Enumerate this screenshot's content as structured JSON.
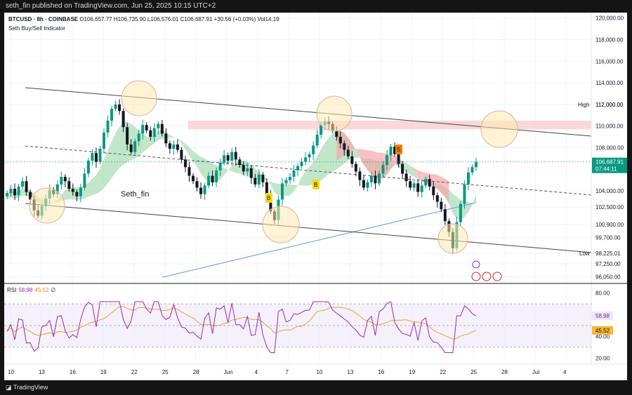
{
  "header": {
    "publisher_line": "seth_fin published on TradingView.com, Jun 25, 2025 10:15 UTC+2"
  },
  "legend": {
    "symbol": "BTCUSD · 8h · COINBASE",
    "ohlc": "O106,657.77 H106,735.90 L106,576.01 C106,687.91 +30.56 (+0.03%) Vol14.19",
    "indicator": "Seth Buy/Sell Indicator"
  },
  "watermark": "Seth_fin",
  "price_labels": {
    "high_label": "High",
    "high_value": "112,000.00",
    "low_label": "Low",
    "low_value": "98,225.01",
    "current_price": "106,687.91",
    "countdown": "07:44:11"
  },
  "rsi_legend": {
    "name": "RSI",
    "value1": "58.98",
    "value2": "45.52",
    "icon": "∅"
  },
  "rsi_labels": {
    "rsi": "58.98",
    "ma": "45.52"
  },
  "signals": [
    "B",
    "B",
    "S"
  ],
  "footer": {
    "brand": "TradingView"
  },
  "colors": {
    "up": "#089981",
    "down": "#131722",
    "cloud_green": "#8fd19e",
    "cloud_red": "#f3a6aa",
    "resistance_zone": "#f8c8ca",
    "circle_fill": "#fde9b0",
    "circle_stroke": "#e0b0a0",
    "ma_blue": "#7aa7e0",
    "rsi_line": "#9c27b0",
    "rsi_ma": "#f0a030",
    "rsi_band": "#ede7f6",
    "buy_badge": "#f5d90a",
    "sell_badge": "#f57c00",
    "price_tag": "#089981"
  },
  "chart_data": {
    "type": "candlestick",
    "symbol": "BTCUSD",
    "exchange": "COINBASE",
    "timeframe": "8h",
    "price_axis": {
      "ticks": [
        "120,000.00",
        "118,000.00",
        "116,000.00",
        "114,000.00",
        "112,000.00",
        "110,000.00",
        "108,000.00",
        "104,000.00",
        "102,500.00",
        "100,900.00",
        "99,700.00",
        "98,225.01",
        "97,250.00",
        "96,050.00"
      ],
      "range": [
        95500,
        120500
      ]
    },
    "time_axis": {
      "ticks": [
        "10",
        "13",
        "16",
        "19",
        "22",
        "25",
        "28",
        "Jun",
        "4",
        "7",
        "10",
        "13",
        "16",
        "19",
        "22",
        "25",
        "28",
        "Jul",
        "4"
      ]
    },
    "series_close": [
      103800,
      104200,
      103600,
      104400,
      104900,
      103900,
      103200,
      102200,
      101700,
      102600,
      103300,
      104100,
      103700,
      104600,
      105300,
      104900,
      104200,
      103900,
      103500,
      104300,
      105600,
      106800,
      107500,
      106700,
      107900,
      109400,
      110500,
      111600,
      112000,
      111400,
      109900,
      108300,
      107600,
      108600,
      109300,
      110100,
      109600,
      109000,
      109800,
      110200,
      109300,
      108400,
      107900,
      108300,
      107800,
      106900,
      106200,
      105400,
      104900,
      104300,
      103700,
      104500,
      105400,
      104800,
      105900,
      106600,
      107300,
      106800,
      107600,
      106900,
      106400,
      105800,
      106100,
      105200,
      104600,
      105500,
      104800,
      103600,
      102100,
      101300,
      103200,
      104700,
      105000,
      105300,
      105900,
      106300,
      106700,
      107100,
      107400,
      108200,
      109200,
      110100,
      110400,
      110200,
      109600,
      109000,
      108400,
      107800,
      107200,
      106500,
      105800,
      105000,
      104300,
      104800,
      105400,
      104700,
      105600,
      106400,
      107300,
      108100,
      107400,
      106500,
      105600,
      104900,
      104300,
      104700,
      103900,
      104500,
      105100,
      104400,
      103600,
      103000,
      102300,
      101200,
      100200,
      98700,
      101100,
      102800,
      104600,
      105700,
      106200,
      106688
    ],
    "high": 112000,
    "low": 98225.01,
    "last_close": 106687.91,
    "rsi": {
      "current": 58.98,
      "ma": 45.52,
      "axis_ticks": [
        80,
        60,
        40,
        20
      ]
    },
    "signals": [
      {
        "type": "B"
      },
      {
        "type": "B"
      },
      {
        "type": "S"
      }
    ]
  }
}
